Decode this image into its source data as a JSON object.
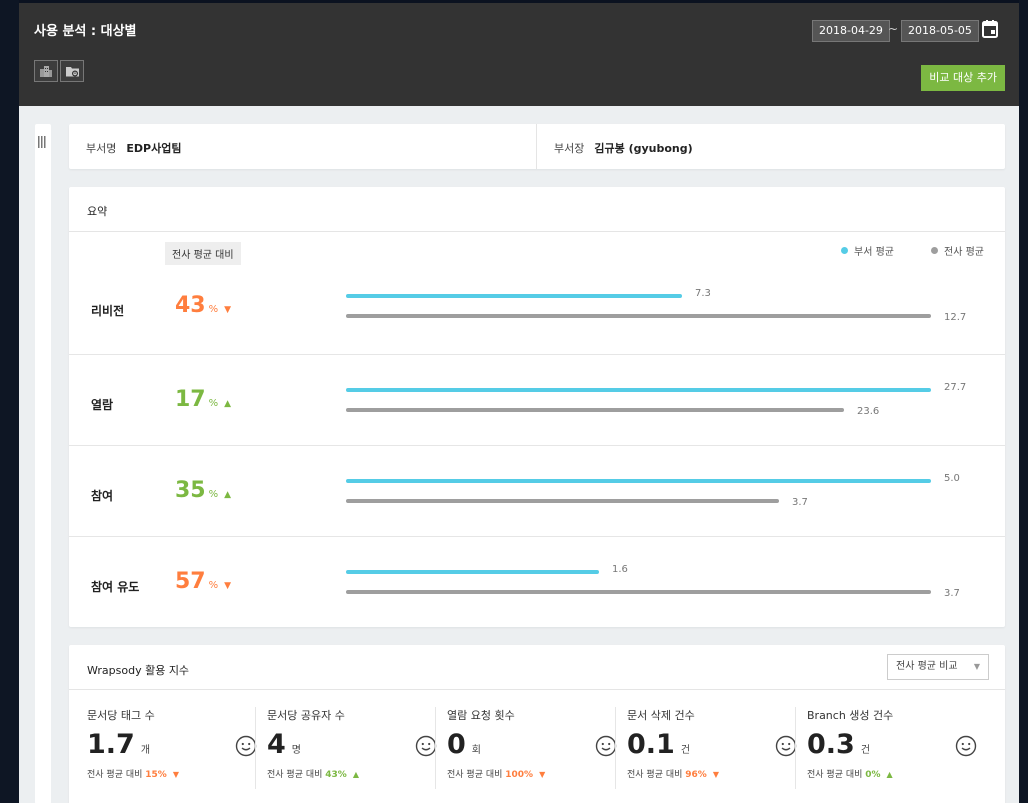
{
  "header": {
    "title": "사용 분석 : 대상별",
    "date_from": "2018-04-29",
    "date_sep": "~",
    "date_to": "2018-05-05",
    "compare_button": "비교 대상 추가",
    "tools": [
      "building-icon",
      "folder-lock-icon"
    ]
  },
  "dept": {
    "name_label": "부서명",
    "name_value": "EDP사업팀",
    "head_label": "부서장",
    "head_value": "김규봉 (gyubong)"
  },
  "summary": {
    "title": "요약",
    "compare_tag": "전사 평균 대비",
    "legend_dept": "부서 평균",
    "legend_corp": "전사 평균",
    "colors": {
      "dept": "#55cce6",
      "corp": "#9e9e9e",
      "down": "#ff7e3e",
      "up": "#7cb842"
    },
    "rows": [
      {
        "label": "리비전",
        "pct": "43",
        "unit": "%",
        "direction": "down",
        "dept": "7.3",
        "corp": "12.7"
      },
      {
        "label": "열람",
        "pct": "17",
        "unit": "%",
        "direction": "up",
        "dept": "27.7",
        "corp": "23.6"
      },
      {
        "label": "참여",
        "pct": "35",
        "unit": "%",
        "direction": "up",
        "dept": "5.0",
        "corp": "3.7"
      },
      {
        "label": "참여 유도",
        "pct": "57",
        "unit": "%",
        "direction": "down",
        "dept": "1.6",
        "corp": "3.7"
      }
    ]
  },
  "index": {
    "title": "Wrapsody 활용 지수",
    "select_value": "전사 평균 비교",
    "foot_prefix": "전사 평균 대비",
    "stats": [
      {
        "title": "문서당 태그 수",
        "value": "1.7",
        "unit": "개",
        "foot": "15%",
        "direction": "down"
      },
      {
        "title": "문서당 공유자 수",
        "value": "4",
        "unit": "명",
        "foot": "43%",
        "direction": "up"
      },
      {
        "title": "열람 요청 횟수",
        "value": "0",
        "unit": "회",
        "foot": "100%",
        "direction": "down"
      },
      {
        "title": "문서 삭제 건수",
        "value": "0.1",
        "unit": "건",
        "foot": "96%",
        "direction": "down"
      },
      {
        "title": "Branch 생성 건수",
        "value": "0.3",
        "unit": "건",
        "foot": "0%",
        "direction": "up"
      }
    ]
  }
}
